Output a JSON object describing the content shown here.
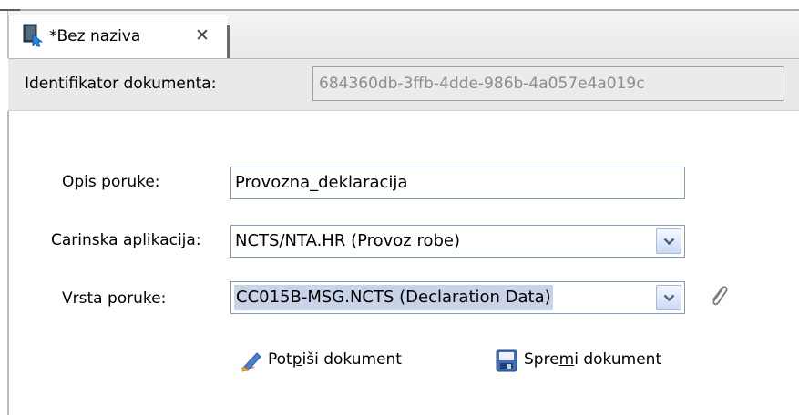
{
  "tab": {
    "title": "*Bez naziva",
    "close_glyph": "✕",
    "icon": "document-tab-icon"
  },
  "header": {
    "id_label": "Identifikator dokumenta:",
    "id_value": "684360db-3ffb-4dde-986b-4a057e4a019c"
  },
  "form": {
    "opis_label": "Opis poruke:",
    "opis_value": "Provozna_deklaracija",
    "app_label": "Carinska aplikacija:",
    "app_value": "NCTS/NTA.HR (Provoz robe)",
    "vrsta_label": "Vrsta poruke:",
    "vrsta_value": "CC015B-MSG.NCTS (Declaration Data)"
  },
  "actions": {
    "sign_pre": "Pot",
    "sign_mnemonic": "p",
    "sign_post": "iši dokument",
    "save_pre": "Spre",
    "save_mnemonic": "m",
    "save_post": "i dokument"
  },
  "colors": {
    "field_border": "#7f9db9",
    "selection": "#c8d3e8",
    "disabled_text": "#8d8d8d"
  }
}
